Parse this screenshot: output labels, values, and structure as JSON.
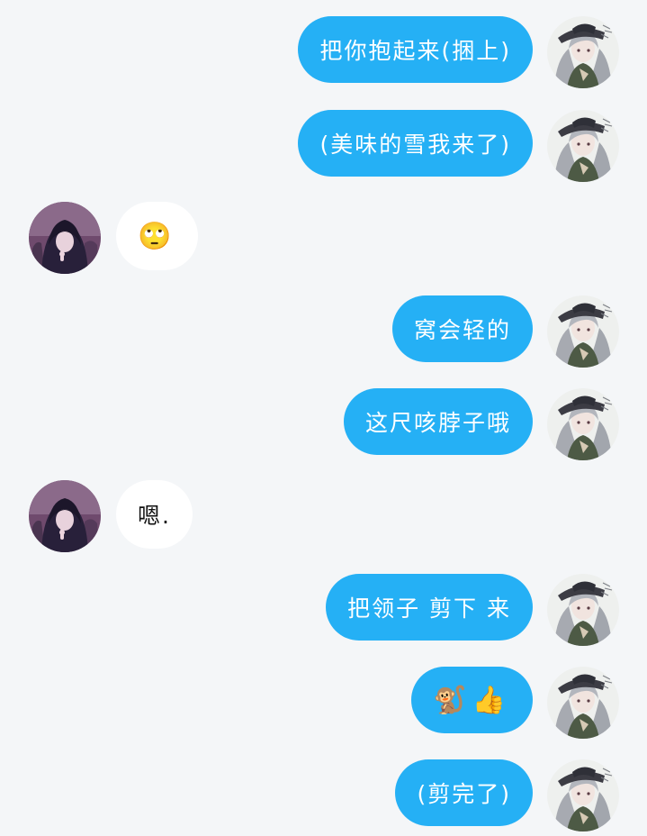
{
  "messages": [
    {
      "side": "out",
      "text": "把你抱起来(捆上)"
    },
    {
      "side": "out",
      "text": "(美味的雪我来了)"
    },
    {
      "side": "in",
      "text": "🙄"
    },
    {
      "side": "out",
      "text": "窝会轻的"
    },
    {
      "side": "out",
      "text": "这尺咳脖子哦"
    },
    {
      "side": "in",
      "text": "嗯."
    },
    {
      "side": "out",
      "text": "把领子 剪下 来"
    },
    {
      "side": "out",
      "text": "🐒👍"
    },
    {
      "side": "out",
      "text": "(剪完了)"
    }
  ],
  "colors": {
    "outgoing_bubble": "#25b0f5",
    "incoming_bubble": "#ffffff",
    "background": "#f4f6f8"
  }
}
